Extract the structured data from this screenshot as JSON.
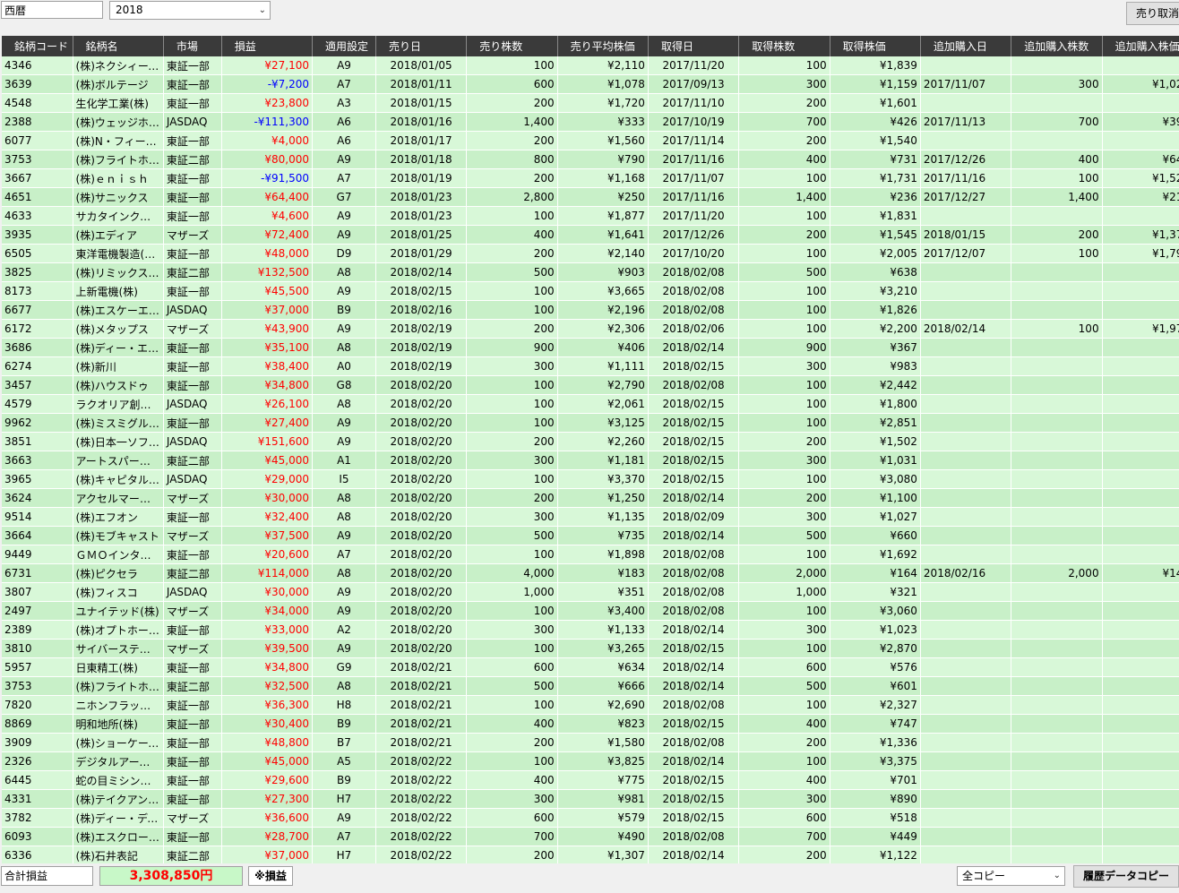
{
  "top": {
    "era_label": "西暦",
    "year_value": "2018",
    "cancel_sell_label": "売り取消し"
  },
  "columns": [
    "銘柄コード",
    "銘柄名",
    "市場",
    "損益",
    "適用設定",
    "売り日",
    "売り株数",
    "売り平均株価",
    "取得日",
    "取得株数",
    "取得株価",
    "追加購入日",
    "追加購入株数",
    "追加購入株価"
  ],
  "rows": [
    [
      "4346",
      "(株)ネクシィーズ…",
      "東証一部",
      "¥27,100",
      "A9",
      "2018/01/05",
      "100",
      "¥2,110",
      "2017/11/20",
      "100",
      "¥1,839",
      "",
      "",
      ""
    ],
    [
      "3639",
      "(株)ボルテージ",
      "東証一部",
      "-¥7,200",
      "A7",
      "2018/01/11",
      "600",
      "¥1,078",
      "2017/09/13",
      "300",
      "¥1,159",
      "2017/11/07",
      "300",
      "¥1,021"
    ],
    [
      "4548",
      "生化学工業(株)",
      "東証一部",
      "¥23,800",
      "A3",
      "2018/01/15",
      "200",
      "¥1,720",
      "2017/11/10",
      "200",
      "¥1,601",
      "",
      "",
      ""
    ],
    [
      "2388",
      "(株)ウェッジホー…",
      "JASDAQ",
      "-¥111,300",
      "A6",
      "2018/01/16",
      "1,400",
      "¥333",
      "2017/10/19",
      "700",
      "¥426",
      "2017/11/13",
      "700",
      "¥399"
    ],
    [
      "6077",
      "(株)N・フィールド",
      "東証一部",
      "¥4,000",
      "A6",
      "2018/01/17",
      "200",
      "¥1,560",
      "2017/11/14",
      "200",
      "¥1,540",
      "",
      "",
      ""
    ],
    [
      "3753",
      "(株)フライトホー…",
      "東証二部",
      "¥80,000",
      "A9",
      "2018/01/18",
      "800",
      "¥790",
      "2017/11/16",
      "400",
      "¥731",
      "2017/12/26",
      "400",
      "¥649"
    ],
    [
      "3667",
      "(株)ｅｎｉｓｈ",
      "東証一部",
      "-¥91,500",
      "A7",
      "2018/01/19",
      "200",
      "¥1,168",
      "2017/11/07",
      "100",
      "¥1,731",
      "2017/11/16",
      "100",
      "¥1,520"
    ],
    [
      "4651",
      "(株)サニックス",
      "東証一部",
      "¥64,400",
      "G7",
      "2018/01/23",
      "2,800",
      "¥250",
      "2017/11/16",
      "1,400",
      "¥236",
      "2017/12/27",
      "1,400",
      "¥218"
    ],
    [
      "4633",
      "サカタインクス(株)",
      "東証一部",
      "¥4,600",
      "A9",
      "2018/01/23",
      "100",
      "¥1,877",
      "2017/11/20",
      "100",
      "¥1,831",
      "",
      "",
      ""
    ],
    [
      "3935",
      "(株)エディア",
      "マザーズ",
      "¥72,400",
      "A9",
      "2018/01/25",
      "400",
      "¥1,641",
      "2017/12/26",
      "200",
      "¥1,545",
      "2018/01/15",
      "200",
      "¥1,375"
    ],
    [
      "6505",
      "東洋電機製造(…",
      "東証一部",
      "¥48,000",
      "D9",
      "2018/01/29",
      "200",
      "¥2,140",
      "2017/10/20",
      "100",
      "¥2,005",
      "2017/12/07",
      "100",
      "¥1,795"
    ],
    [
      "3825",
      "(株)リミックスポイ…",
      "東証二部",
      "¥132,500",
      "A8",
      "2018/02/14",
      "500",
      "¥903",
      "2018/02/08",
      "500",
      "¥638",
      "",
      "",
      ""
    ],
    [
      "8173",
      "上新電機(株)",
      "東証一部",
      "¥45,500",
      "A9",
      "2018/02/15",
      "100",
      "¥3,665",
      "2018/02/08",
      "100",
      "¥3,210",
      "",
      "",
      ""
    ],
    [
      "6677",
      "(株)エスケーエレ…",
      "JASDAQ",
      "¥37,000",
      "B9",
      "2018/02/16",
      "100",
      "¥2,196",
      "2018/02/08",
      "100",
      "¥1,826",
      "",
      "",
      ""
    ],
    [
      "6172",
      "(株)メタップス",
      "マザーズ",
      "¥43,900",
      "A9",
      "2018/02/19",
      "200",
      "¥2,306",
      "2018/02/06",
      "100",
      "¥2,200",
      "2018/02/14",
      "100",
      "¥1,973"
    ],
    [
      "3686",
      "(株)ディー・エル・…",
      "東証一部",
      "¥35,100",
      "A8",
      "2018/02/19",
      "900",
      "¥406",
      "2018/02/14",
      "900",
      "¥367",
      "",
      "",
      ""
    ],
    [
      "6274",
      "(株)新川",
      "東証一部",
      "¥38,400",
      "A0",
      "2018/02/19",
      "300",
      "¥1,111",
      "2018/02/15",
      "300",
      "¥983",
      "",
      "",
      ""
    ],
    [
      "3457",
      "(株)ハウスドゥ",
      "東証一部",
      "¥34,800",
      "G8",
      "2018/02/20",
      "100",
      "¥2,790",
      "2018/02/08",
      "100",
      "¥2,442",
      "",
      "",
      ""
    ],
    [
      "4579",
      "ラクオリア創薬(株)",
      "JASDAQ",
      "¥26,100",
      "A8",
      "2018/02/20",
      "100",
      "¥2,061",
      "2018/02/15",
      "100",
      "¥1,800",
      "",
      "",
      ""
    ],
    [
      "9962",
      "(株)ミスミグルー…",
      "東証一部",
      "¥27,400",
      "A9",
      "2018/02/20",
      "100",
      "¥3,125",
      "2018/02/15",
      "100",
      "¥2,851",
      "",
      "",
      ""
    ],
    [
      "3851",
      "(株)日本一ソフ…",
      "JASDAQ",
      "¥151,600",
      "A9",
      "2018/02/20",
      "200",
      "¥2,260",
      "2018/02/15",
      "200",
      "¥1,502",
      "",
      "",
      ""
    ],
    [
      "3663",
      "アートスパークホ…",
      "東証二部",
      "¥45,000",
      "A1",
      "2018/02/20",
      "300",
      "¥1,181",
      "2018/02/15",
      "300",
      "¥1,031",
      "",
      "",
      ""
    ],
    [
      "3965",
      "(株)キャピタル・…",
      "JASDAQ",
      "¥29,000",
      "I5",
      "2018/02/20",
      "100",
      "¥3,370",
      "2018/02/15",
      "100",
      "¥3,080",
      "",
      "",
      ""
    ],
    [
      "3624",
      "アクセルマーク(株)",
      "マザーズ",
      "¥30,000",
      "A8",
      "2018/02/20",
      "200",
      "¥1,250",
      "2018/02/14",
      "200",
      "¥1,100",
      "",
      "",
      ""
    ],
    [
      "9514",
      "(株)エフオン",
      "東証一部",
      "¥32,400",
      "A8",
      "2018/02/20",
      "300",
      "¥1,135",
      "2018/02/09",
      "300",
      "¥1,027",
      "",
      "",
      ""
    ],
    [
      "3664",
      "(株)モブキャスト",
      "マザーズ",
      "¥37,500",
      "A9",
      "2018/02/20",
      "500",
      "¥735",
      "2018/02/14",
      "500",
      "¥660",
      "",
      "",
      ""
    ],
    [
      "9449",
      "ＧＭＯインター…",
      "東証一部",
      "¥20,600",
      "A7",
      "2018/02/20",
      "100",
      "¥1,898",
      "2018/02/08",
      "100",
      "¥1,692",
      "",
      "",
      ""
    ],
    [
      "6731",
      "(株)ピクセラ",
      "東証二部",
      "¥114,000",
      "A8",
      "2018/02/20",
      "4,000",
      "¥183",
      "2018/02/08",
      "2,000",
      "¥164",
      "2018/02/16",
      "2,000",
      "¥145"
    ],
    [
      "3807",
      "(株)フィスコ",
      "JASDAQ",
      "¥30,000",
      "A9",
      "2018/02/20",
      "1,000",
      "¥351",
      "2018/02/08",
      "1,000",
      "¥321",
      "",
      "",
      ""
    ],
    [
      "2497",
      "ユナイテッド(株)",
      "マザーズ",
      "¥34,000",
      "A9",
      "2018/02/20",
      "100",
      "¥3,400",
      "2018/02/08",
      "100",
      "¥3,060",
      "",
      "",
      ""
    ],
    [
      "2389",
      "(株)オプトホール…",
      "東証一部",
      "¥33,000",
      "A2",
      "2018/02/20",
      "300",
      "¥1,133",
      "2018/02/14",
      "300",
      "¥1,023",
      "",
      "",
      ""
    ],
    [
      "3810",
      "サイバーステップ(…",
      "マザーズ",
      "¥39,500",
      "A9",
      "2018/02/20",
      "100",
      "¥3,265",
      "2018/02/15",
      "100",
      "¥2,870",
      "",
      "",
      ""
    ],
    [
      "5957",
      "日東精工(株)",
      "東証一部",
      "¥34,800",
      "G9",
      "2018/02/21",
      "600",
      "¥634",
      "2018/02/14",
      "600",
      "¥576",
      "",
      "",
      ""
    ],
    [
      "3753",
      "(株)フライトホー…",
      "東証二部",
      "¥32,500",
      "A8",
      "2018/02/21",
      "500",
      "¥666",
      "2018/02/14",
      "500",
      "¥601",
      "",
      "",
      ""
    ],
    [
      "7820",
      "ニホンフラッシュ(株)",
      "東証一部",
      "¥36,300",
      "H8",
      "2018/02/21",
      "100",
      "¥2,690",
      "2018/02/08",
      "100",
      "¥2,327",
      "",
      "",
      ""
    ],
    [
      "8869",
      "明和地所(株)",
      "東証一部",
      "¥30,400",
      "B9",
      "2018/02/21",
      "400",
      "¥823",
      "2018/02/15",
      "400",
      "¥747",
      "",
      "",
      ""
    ],
    [
      "3909",
      "(株)ショーケース…",
      "東証一部",
      "¥48,800",
      "B7",
      "2018/02/21",
      "200",
      "¥1,580",
      "2018/02/08",
      "200",
      "¥1,336",
      "",
      "",
      ""
    ],
    [
      "2326",
      "デジタルアーツ(株)",
      "東証一部",
      "¥45,000",
      "A5",
      "2018/02/22",
      "100",
      "¥3,825",
      "2018/02/14",
      "100",
      "¥3,375",
      "",
      "",
      ""
    ],
    [
      "6445",
      "蛇の目ミシン工…",
      "東証一部",
      "¥29,600",
      "B9",
      "2018/02/22",
      "400",
      "¥775",
      "2018/02/15",
      "400",
      "¥701",
      "",
      "",
      ""
    ],
    [
      "4331",
      "(株)テイクアンド…",
      "東証一部",
      "¥27,300",
      "H7",
      "2018/02/22",
      "300",
      "¥981",
      "2018/02/15",
      "300",
      "¥890",
      "",
      "",
      ""
    ],
    [
      "3782",
      "(株)ディー・ディ…",
      "マザーズ",
      "¥36,600",
      "A9",
      "2018/02/22",
      "600",
      "¥579",
      "2018/02/15",
      "600",
      "¥518",
      "",
      "",
      ""
    ],
    [
      "6093",
      "(株)エスクロー・…",
      "東証一部",
      "¥28,700",
      "A7",
      "2018/02/22",
      "700",
      "¥490",
      "2018/02/08",
      "700",
      "¥449",
      "",
      "",
      ""
    ],
    [
      "6336",
      "(株)石井表記",
      "東証二部",
      "¥37,000",
      "H7",
      "2018/02/22",
      "200",
      "¥1,307",
      "2018/02/14",
      "200",
      "¥1,122",
      "",
      "",
      ""
    ]
  ],
  "bottom": {
    "total_label": "合計損益",
    "total_value": "3,308,850円",
    "note": "※損益",
    "copy_select_value": "全コピー",
    "history_copy_label": "履歴データコピー"
  },
  "colors": {
    "profit": "#ff0000",
    "loss": "#0000ff",
    "header_bg": "#3a3a3a",
    "row_bg": "#c8f0c8"
  }
}
